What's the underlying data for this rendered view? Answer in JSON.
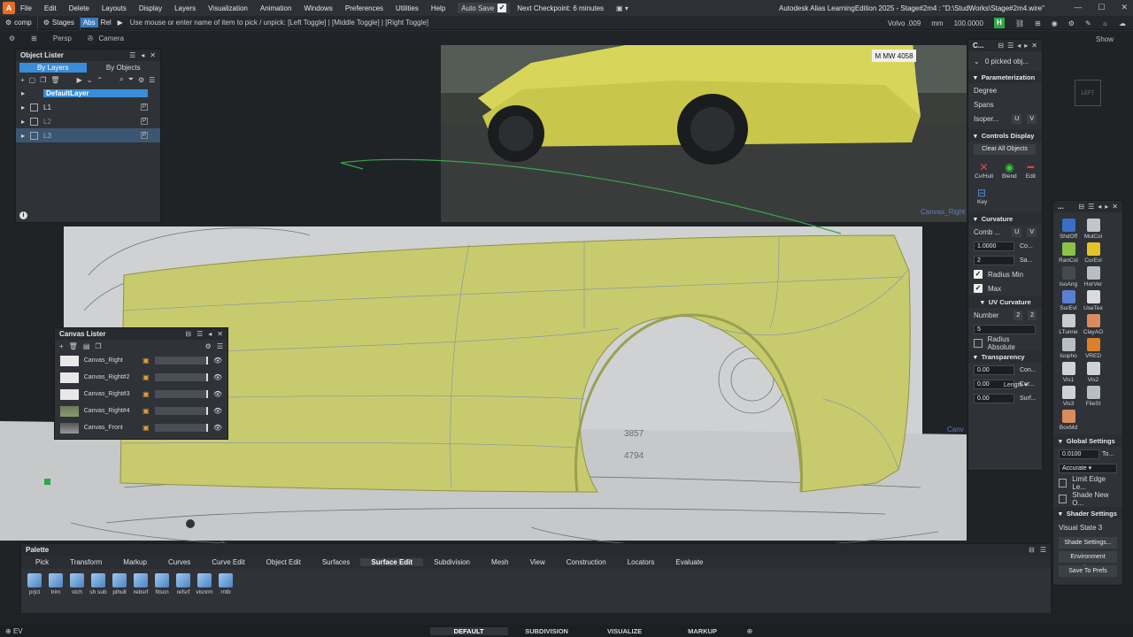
{
  "menubar": {
    "items": [
      "File",
      "Edit",
      "Delete",
      "Layouts",
      "Display",
      "Layers",
      "Visualization",
      "Animation",
      "Windows",
      "Preferences",
      "Utilities",
      "Help"
    ],
    "autosave_label": "Auto Save",
    "next_checkpoint": "Next Checkpoint: 6 minutes",
    "title": "Autodesk Alias LearningEdition 2025  - Stage#2m4 : \"D:\\StudWorks\\Stage#2m4.wire\""
  },
  "toolbar": {
    "comp": "comp",
    "stages": "Stages",
    "abs": "Abs",
    "rel": "Rel",
    "hint": "Use mouse or enter name of item to pick / unpick: [Left Toggle] | [Middle Toggle] | [Right Toggle]",
    "object_name": "Volvo .009",
    "unit": "mm",
    "scale": "100.0000"
  },
  "viewbar": {
    "persp": "Persp",
    "camera": "Camera",
    "show": "Show"
  },
  "object_lister": {
    "title": "Object Lister",
    "tab_layers": "By Layers",
    "tab_objects": "By Objects",
    "layers": [
      {
        "name": "DefaultLayer",
        "selected": true
      },
      {
        "name": "L1",
        "selected": false
      },
      {
        "name": "L2",
        "selected": false
      },
      {
        "name": "L3",
        "selected": true
      }
    ]
  },
  "canvas_lister": {
    "title": "Canvas Lister",
    "items": [
      "Canvas_Right",
      "Canvas_Right#2",
      "Canvas_Right#3",
      "Canvas_Right#4",
      "Canvas_Front"
    ]
  },
  "viewport_labels": {
    "canvas_right": "Canvas_Right",
    "canvas_right_trunc": "Canv",
    "dim1": "3857",
    "dim2": "4794"
  },
  "plate": "M MW 4058",
  "control_panel": {
    "title": "C...",
    "picked": "0 picked obj...",
    "parameterization": "Parameterization",
    "degree": "Degree",
    "spans": "Spans",
    "isoparm": "Isoper...",
    "u": "U",
    "v": "V",
    "controls_display": "Controls Display",
    "clear_all": "Clear All Objects",
    "cv_hull": "Cv/Hull",
    "blend": "Blend",
    "edit": "Edit",
    "key": "Key",
    "curvature": "Curvature",
    "comb": "Comb ...",
    "comb_val": "1.0000",
    "comb_btn": "Co...",
    "samples_val": "2",
    "samples_btn": "Sa...",
    "radius_min": "Radius Min",
    "max": "Max",
    "uv_curvature": "UV Curvature",
    "number": "Number",
    "num_u": "2",
    "num_v": "2",
    "length_num": "5",
    "length": "Length",
    "radius_absolute": "Radius Absolute",
    "transparency": "Transparency",
    "transp": [
      {
        "value": "0.00",
        "label": "Con..."
      },
      {
        "value": "0.00",
        "label": "Cur..."
      },
      {
        "value": "0.00",
        "label": "Surf..."
      }
    ]
  },
  "shelf_panel": {
    "title": "...",
    "icons": [
      {
        "label": "ShdOff",
        "color": "#3a6fc4"
      },
      {
        "label": "MulCol",
        "color": "#c2c6cc"
      },
      {
        "label": "RanCol",
        "color": "#8bc34a"
      },
      {
        "label": "CurEvl",
        "color": "#e6c229"
      },
      {
        "label": "IsoAng",
        "color": "#444a52"
      },
      {
        "label": "HorVer",
        "color": "#b9bec5"
      },
      {
        "label": "SurEvl",
        "color": "#5b7fd0"
      },
      {
        "label": "UseTex",
        "color": "#d8dbe0"
      },
      {
        "label": "LTunne",
        "color": "#c8ccd1"
      },
      {
        "label": "ClayAO",
        "color": "#d98c5f"
      },
      {
        "label": "Isopho",
        "color": "#b9bec5"
      },
      {
        "label": "VRED",
        "color": "#d9822b"
      },
      {
        "label": "Vis1",
        "color": "#cfd3d8"
      },
      {
        "label": "Vis2",
        "color": "#cfd3d8"
      },
      {
        "label": "Vis3",
        "color": "#cfd3d8"
      },
      {
        "label": "FileSt",
        "color": "#b9bec5"
      },
      {
        "label": "BoxMd",
        "color": "#d98c5f"
      }
    ],
    "global_settings": "Global Settings",
    "tol_val": "0.0100",
    "tol_btn": "To...",
    "accurate": "Accurate",
    "limit_edge": "Limit Edge Le...",
    "shade_new": "Shade New O...",
    "shader_settings": "Shader Settings",
    "visual_state": "Visual State 3",
    "shade_settings_btn": "Shade Settings...",
    "env_editor_btn": "Environment Editor...",
    "save_prefs_btn": "Save To Prefs"
  },
  "palette": {
    "title": "Palette",
    "tabs": [
      "Pick",
      "Transform",
      "Markup",
      "Curves",
      "Curve Edit",
      "Object Edit",
      "Surfaces",
      "Surface Edit",
      "Subdivision",
      "Mesh",
      "View",
      "Construction",
      "Locators",
      "Evaluate"
    ],
    "active_tab": "Surface Edit",
    "tools": [
      "prjct",
      "trim",
      "stch",
      "sh sub",
      "plhull",
      "rebsrf",
      "fitscn",
      "refsrf",
      "visnrm",
      "rntb"
    ]
  },
  "status": {
    "ev": "EV",
    "modes": [
      "DEFAULT",
      "SUBDIVISION",
      "VISUALIZE",
      "MARKUP"
    ],
    "active_mode": "DEFAULT"
  }
}
